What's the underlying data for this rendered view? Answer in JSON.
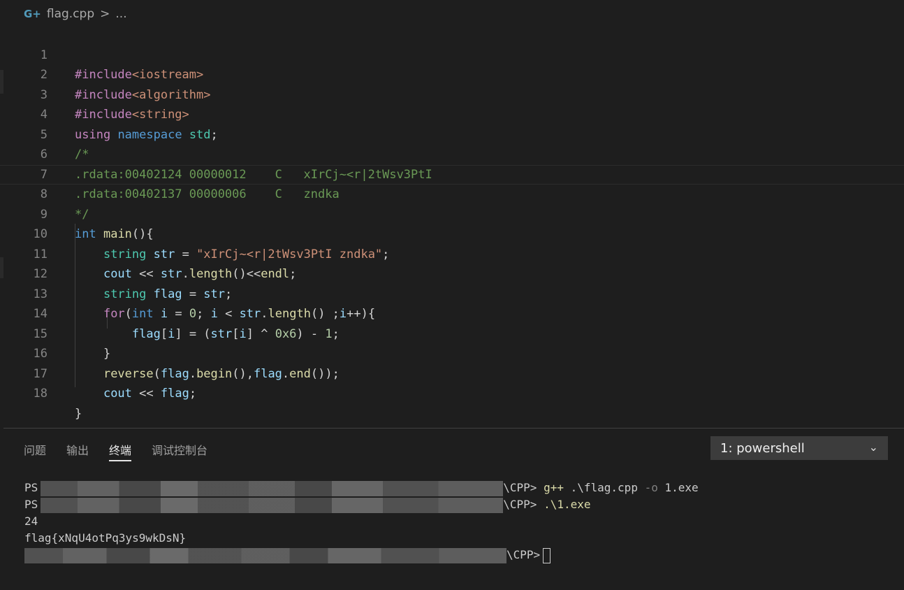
{
  "breadcrumb": {
    "file": "flag.cpp",
    "separator": ">",
    "more": "..."
  },
  "code": {
    "line_numbers": [
      "1",
      "2",
      "3",
      "4",
      "5",
      "6",
      "7",
      "8",
      "9",
      "10",
      "11",
      "12",
      "13",
      "14",
      "15",
      "16",
      "17",
      "18"
    ],
    "l1": {
      "pp": "#include",
      "inc": "<iostream>"
    },
    "l2": {
      "pp": "#include",
      "inc": "<algorithm>"
    },
    "l3": {
      "pp": "#include",
      "inc": "<string>"
    },
    "l4": {
      "kw1": "using",
      "kw2": "namespace",
      "ns": "std",
      "semi": ";"
    },
    "l5": {
      "cm": "/*"
    },
    "l6": {
      "cm": ".rdata:00402124 00000012    C   xIrCj~<r|2tWsv3PtI"
    },
    "l7": {
      "cm": ".rdata:00402137 00000006    C   zndka"
    },
    "l8": {
      "cm": "*/"
    },
    "l9": {
      "kw": "int",
      "fn": "main",
      "rest": "(){"
    },
    "l10": {
      "ty": "string",
      "va": "str",
      "eq": " = ",
      "st": "\"xIrCj~<r|2tWsv3PtI zndka\"",
      "semi": ";"
    },
    "l11": {
      "va1": "cout",
      "op1": " << ",
      "va2": "str",
      "dot": ".",
      "fn": "length",
      "rest": "()<<",
      "va3": "endl",
      "semi": ";"
    },
    "l12": {
      "ty": "string",
      "va1": "flag",
      "eq": " = ",
      "va2": "str",
      "semi": ";"
    },
    "l13": {
      "ct": "for",
      "p1": "(",
      "kw": "int",
      "va1": "i",
      "eq": " = ",
      "nu": "0",
      "s1": "; ",
      "va2": "i",
      "lt": " < ",
      "va3": "str",
      "dot": ".",
      "fn": "length",
      "rest1": "() ;",
      "va4": "i",
      "rest2": "++){"
    },
    "l14": {
      "va1": "flag",
      "b1": "[",
      "va2": "i",
      "b2": "] = (",
      "va3": "str",
      "b3": "[",
      "va4": "i",
      "b4": "] ^ ",
      "nu1": "0x6",
      "b5": ") - ",
      "nu2": "1",
      "semi": ";"
    },
    "l15": {
      "brace": "}"
    },
    "l16": {
      "fn1": "reverse",
      "p1": "(",
      "va1": "flag",
      "d1": ".",
      "fn2": "begin",
      "p2": "(),",
      "va2": "flag",
      "d2": ".",
      "fn3": "end",
      "p3": "());"
    },
    "l17": {
      "va1": "cout",
      "op": " << ",
      "va2": "flag",
      "semi": ";"
    },
    "l18": {
      "brace": "}"
    }
  },
  "panel": {
    "tabs": [
      "问题",
      "输出",
      "终端",
      "调试控制台"
    ],
    "active_tab": "终端",
    "terminal_select": "1: powershell"
  },
  "terminal": {
    "line1": {
      "prompt": "PS",
      "path_end": "\\CPP>",
      "cmd": "g++",
      "arg1": " .\\flag.cpp ",
      "flag": "-o",
      "arg2": " 1.exe"
    },
    "line2": {
      "prompt": "PS",
      "path_end": "\\CPP>",
      "cmd": ".\\1.exe"
    },
    "line3": "24",
    "line4": "flag{xNqU4otPq3ys9wkDsN}",
    "line5": {
      "path_end": "\\CPP>"
    }
  },
  "colors": {
    "keyword": "#569cd6",
    "type": "#4ec9b0",
    "function": "#dcdcaa",
    "variable": "#9cdcfe",
    "string": "#ce9178",
    "number": "#b5cea8",
    "comment": "#6a9955",
    "preprocessor": "#c586c0"
  }
}
